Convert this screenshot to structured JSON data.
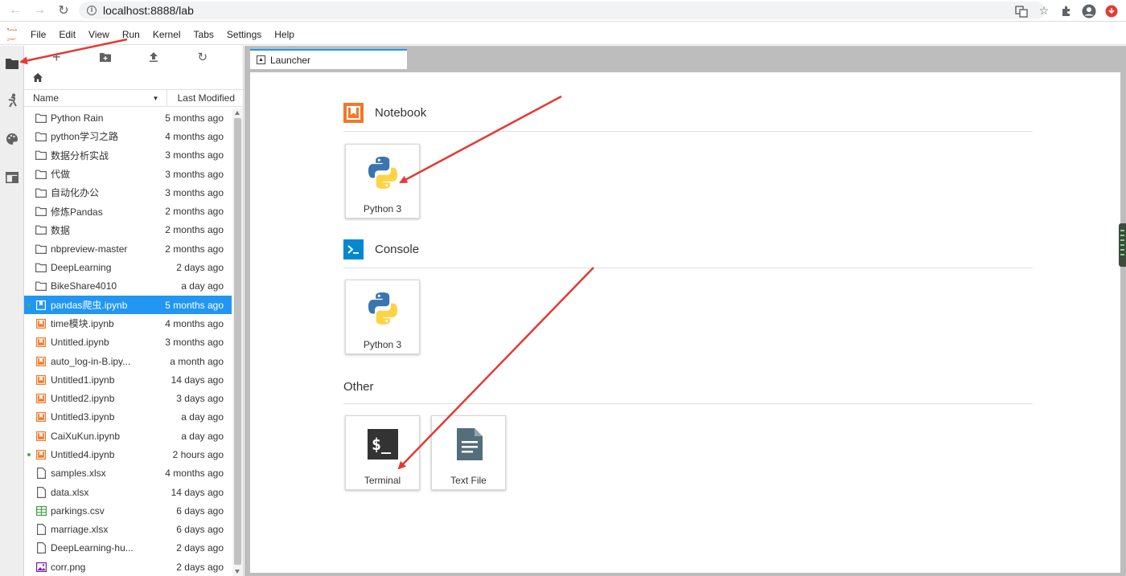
{
  "browser": {
    "url": "localhost:8888/lab"
  },
  "menubar": {
    "items": [
      "File",
      "Edit",
      "View",
      "Run",
      "Kernel",
      "Tabs",
      "Settings",
      "Help"
    ]
  },
  "filebrowser": {
    "header": {
      "name": "Name",
      "modified": "Last Modified"
    },
    "rows": [
      {
        "type": "folder",
        "name": "Python Rain",
        "modified": "5 months ago"
      },
      {
        "type": "folder",
        "name": "python学习之路",
        "modified": "4 months ago"
      },
      {
        "type": "folder",
        "name": "数据分析实战",
        "modified": "3 months ago"
      },
      {
        "type": "folder",
        "name": "代做",
        "modified": "3 months ago"
      },
      {
        "type": "folder",
        "name": "自动化办公",
        "modified": "3 months ago"
      },
      {
        "type": "folder",
        "name": "修炼Pandas",
        "modified": "2 months ago"
      },
      {
        "type": "folder",
        "name": "数据",
        "modified": "2 months ago"
      },
      {
        "type": "folder",
        "name": "nbpreview-master",
        "modified": "2 months ago"
      },
      {
        "type": "folder",
        "name": "DeepLearning",
        "modified": "2 days ago"
      },
      {
        "type": "folder",
        "name": "BikeShare4010",
        "modified": "a day ago"
      },
      {
        "type": "notebook",
        "name": "pandas爬虫.ipynb",
        "modified": "5 months ago",
        "selected": true,
        "running": true
      },
      {
        "type": "notebook",
        "name": "time模块.ipynb",
        "modified": "4 months ago"
      },
      {
        "type": "notebook",
        "name": "Untitled.ipynb",
        "modified": "3 months ago"
      },
      {
        "type": "notebook",
        "name": "auto_log-in-B.ipy...",
        "modified": "a month ago"
      },
      {
        "type": "notebook",
        "name": "Untitled1.ipynb",
        "modified": "14 days ago"
      },
      {
        "type": "notebook",
        "name": "Untitled2.ipynb",
        "modified": "3 days ago"
      },
      {
        "type": "notebook",
        "name": "Untitled3.ipynb",
        "modified": "a day ago"
      },
      {
        "type": "notebook",
        "name": "CaiXuKun.ipynb",
        "modified": "a day ago"
      },
      {
        "type": "notebook",
        "name": "Untitled4.ipynb",
        "modified": "2 hours ago",
        "running": true
      },
      {
        "type": "file",
        "name": "samples.xlsx",
        "modified": "4 months ago"
      },
      {
        "type": "file",
        "name": "data.xlsx",
        "modified": "14 days ago"
      },
      {
        "type": "csv",
        "name": "parkings.csv",
        "modified": "6 days ago"
      },
      {
        "type": "file",
        "name": "marriage.xlsx",
        "modified": "6 days ago"
      },
      {
        "type": "file",
        "name": "DeepLearning-hu...",
        "modified": "2 days ago"
      },
      {
        "type": "image",
        "name": "corr.png",
        "modified": "2 days ago"
      }
    ]
  },
  "tab": {
    "label": "Launcher"
  },
  "launcher": {
    "notebook": {
      "title": "Notebook",
      "cards": [
        "Python 3"
      ]
    },
    "console": {
      "title": "Console",
      "cards": [
        "Python 3"
      ]
    },
    "other": {
      "title": "Other",
      "cards": [
        "Terminal",
        "Text File"
      ]
    }
  },
  "colors": {
    "accent": "#2196f3",
    "notebook_orange": "#f37726",
    "console_blue": "#0288d1",
    "arrow_red": "#e53935"
  }
}
